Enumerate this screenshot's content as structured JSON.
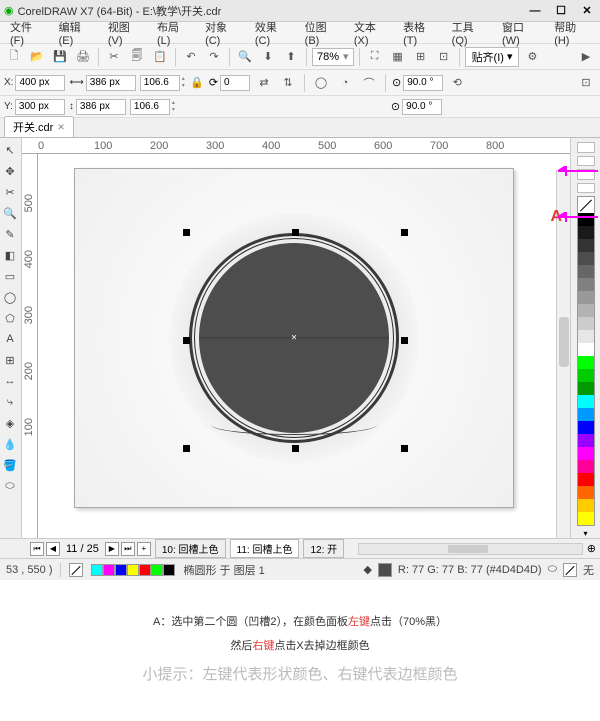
{
  "title_bar": {
    "title": "CorelDRAW X7 (64-Bit) - E:\\教学\\开关.cdr"
  },
  "menu": {
    "items": [
      "文件(F)",
      "编辑(E)",
      "视图(V)",
      "布局(L)",
      "对象(C)",
      "效果(C)",
      "位图(B)",
      "文本(X)",
      "表格(T)",
      "工具(Q)",
      "窗口(W)",
      "帮助(H)"
    ]
  },
  "toolbar1": {
    "zoom": "78%",
    "paste_label": "贴齐(I)"
  },
  "toolbar2": {
    "x_label": "X:",
    "x_value": "400 px",
    "y_label": "Y:",
    "y_value": "300 px",
    "w_value": "386 px",
    "h_value": "386 px",
    "pct1": "106.6",
    "pct2": "106.6",
    "rot": "0",
    "angle1": "90.0 °",
    "angle2": "90.0 °"
  },
  "doc_tab": {
    "name": "开关.cdr"
  },
  "ruler_h": [
    "0",
    "100",
    "200",
    "300",
    "400",
    "500",
    "600",
    "700",
    "800"
  ],
  "ruler_v": [
    "500",
    "400",
    "300",
    "200",
    "100"
  ],
  "annotation_label": "A",
  "bottom": {
    "page_info": "11 / 25",
    "tabs": [
      "10: 回槽上色",
      "11: 回槽上色",
      "12: 开"
    ]
  },
  "status": {
    "coord": "53 , 550 )",
    "object": "椭圆形 于 图层 1",
    "color": "R: 77 G: 77 B: 77 (#4D4D4D)",
    "outline": "无"
  },
  "palette": [
    "#000000",
    "#1a1a1a",
    "#333333",
    "#4d4d4d",
    "#666666",
    "#808080",
    "#999999",
    "#b3b3b3",
    "#cccccc",
    "#e6e6e6",
    "#ffffff",
    "#00ff00",
    "#00cc00",
    "#009900",
    "#00ffff",
    "#0099ff",
    "#0000ff",
    "#9900ff",
    "#ff00ff",
    "#ff0099",
    "#ff0000",
    "#ff6600",
    "#ffcc00",
    "#ffff00"
  ],
  "small_palette": [
    "#00ffff",
    "#ff00ff",
    "#0000ff",
    "#ffff00",
    "#ff0000",
    "#00ff00",
    "#000000"
  ],
  "caption": {
    "line1_a": "A：选中第二个圆（凹槽2），在颜色面板",
    "line1_red1": "左键",
    "line1_b": "点击（70%黑）",
    "line2_a": "然后",
    "line2_red": "右键",
    "line2_b": "点击X去掉边框颜色",
    "tip": "小提示：左键代表形状颜色、右键代表边框颜色"
  }
}
